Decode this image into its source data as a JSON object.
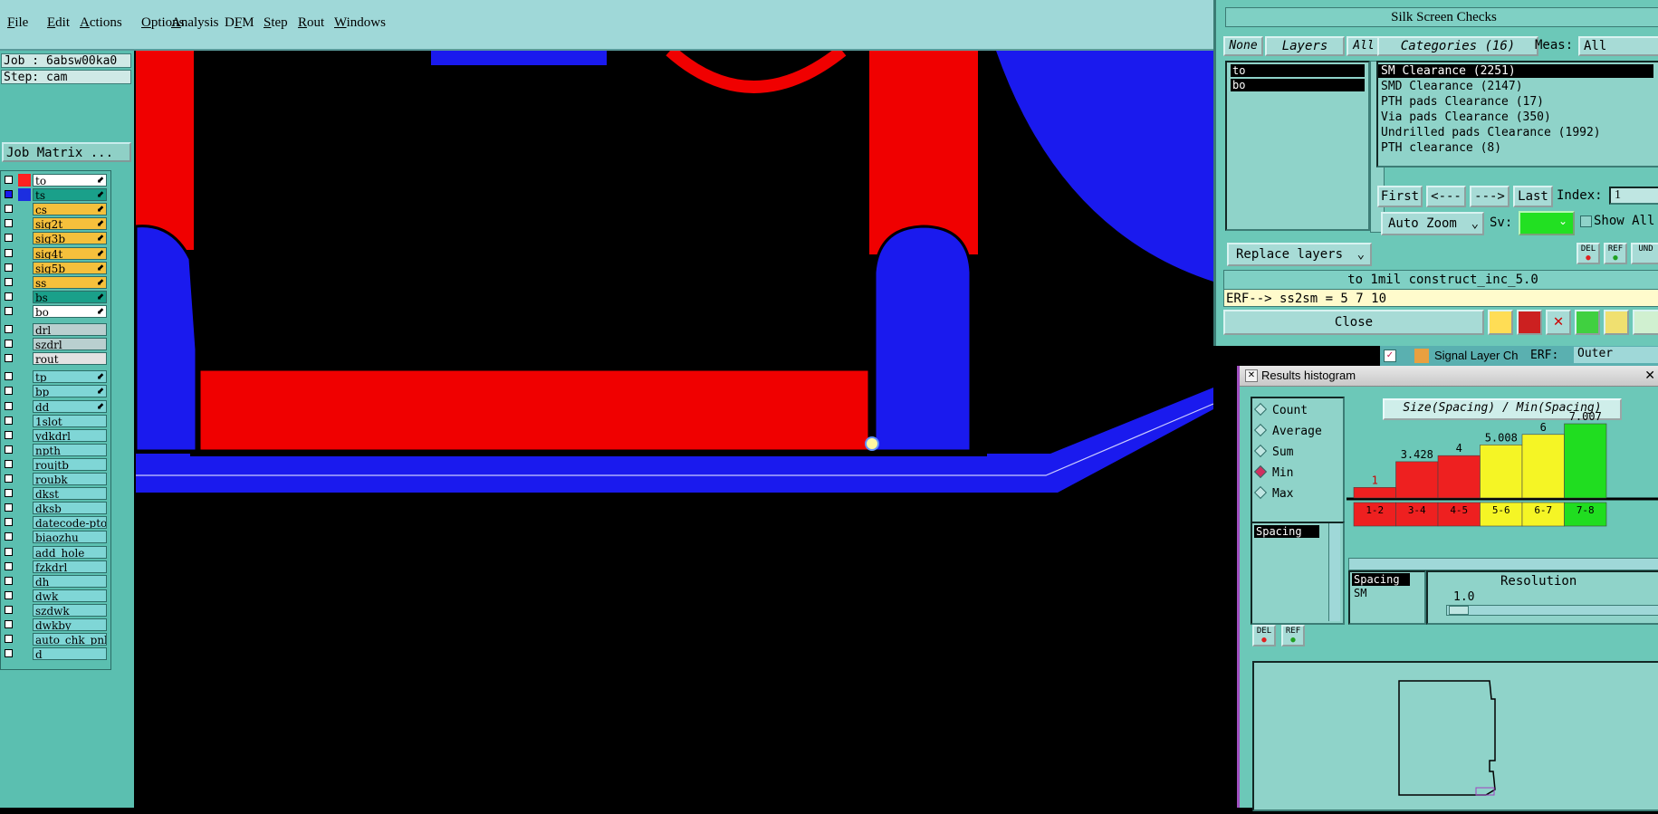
{
  "menubar": {
    "items": [
      {
        "pre": "",
        "u": "F",
        "post": "ile"
      },
      {
        "pre": "",
        "u": "E",
        "post": "dit"
      },
      {
        "pre": "",
        "u": "A",
        "post": "ctions"
      },
      {
        "pre": "",
        "u": "O",
        "post": "ptions"
      },
      {
        "pre": "",
        "u": "A",
        "post": "nalysis"
      },
      {
        "pre": "D",
        "u": "F",
        "post": "M"
      },
      {
        "pre": "",
        "u": "S",
        "post": "tep"
      },
      {
        "pre": "",
        "u": "R",
        "post": "out"
      },
      {
        "pre": "",
        "u": "W",
        "post": "indows"
      }
    ]
  },
  "left": {
    "job": "Job : 6absw00ka0",
    "step": "Step: cam",
    "job_matrix": "Job Matrix ...",
    "layers": [
      {
        "name": "to",
        "swatch": "#ff2020",
        "color": "#ffffff",
        "arrow": true,
        "checked": false
      },
      {
        "name": "ts",
        "swatch": "#1c2ee0",
        "color": "#1aa08a",
        "arrow": true,
        "checked": true
      },
      {
        "name": "cs",
        "swatch": "",
        "color": "#f5c03c",
        "arrow": true,
        "checked": false
      },
      {
        "name": "sig2t",
        "swatch": "",
        "color": "#f5c03c",
        "arrow": true,
        "checked": false
      },
      {
        "name": "sig3b",
        "swatch": "",
        "color": "#f5c03c",
        "arrow": true,
        "checked": false
      },
      {
        "name": "sig4t",
        "swatch": "",
        "color": "#f5c03c",
        "arrow": true,
        "checked": false
      },
      {
        "name": "sig5b",
        "swatch": "",
        "color": "#f5c03c",
        "arrow": true,
        "checked": false
      },
      {
        "name": "ss",
        "swatch": "",
        "color": "#f5c03c",
        "arrow": true,
        "checked": false
      },
      {
        "name": "bs",
        "swatch": "",
        "color": "#1aa08a",
        "arrow": true,
        "checked": false
      },
      {
        "name": "bo",
        "swatch": "",
        "color": "#ffffff",
        "arrow": true,
        "checked": false
      },
      {
        "name": "drl",
        "swatch": "",
        "color": "#b9cfcf",
        "arrow": false,
        "checked": false
      },
      {
        "name": "szdrl",
        "swatch": "",
        "color": "#b9cfcf",
        "arrow": false,
        "checked": false
      },
      {
        "name": "rout",
        "swatch": "",
        "color": "#e2e2e2",
        "arrow": false,
        "checked": false
      },
      {
        "name": "tp",
        "swatch": "",
        "color": "#7fd6d6",
        "arrow": true,
        "checked": false
      },
      {
        "name": "bp",
        "swatch": "",
        "color": "#7fd6d6",
        "arrow": true,
        "checked": false
      },
      {
        "name": "dd",
        "swatch": "",
        "color": "#7fd6d6",
        "arrow": true,
        "checked": false
      },
      {
        "name": "1slot",
        "swatch": "",
        "color": "#7fd6d6",
        "arrow": false,
        "checked": false
      },
      {
        "name": "ydkdrl",
        "swatch": "",
        "color": "#7fd6d6",
        "arrow": false,
        "checked": false
      },
      {
        "name": "npth",
        "swatch": "",
        "color": "#7fd6d6",
        "arrow": false,
        "checked": false
      },
      {
        "name": "roujtb",
        "swatch": "",
        "color": "#7fd6d6",
        "arrow": false,
        "checked": false
      },
      {
        "name": "roubk",
        "swatch": "",
        "color": "#7fd6d6",
        "arrow": false,
        "checked": false
      },
      {
        "name": "dkst",
        "swatch": "",
        "color": "#7fd6d6",
        "arrow": false,
        "checked": false
      },
      {
        "name": "dksb",
        "swatch": "",
        "color": "#7fd6d6",
        "arrow": false,
        "checked": false
      },
      {
        "name": "datecode-pto",
        "swatch": "",
        "color": "#7fd6d6",
        "arrow": false,
        "checked": false
      },
      {
        "name": "biaozhu",
        "swatch": "",
        "color": "#7fd6d6",
        "arrow": false,
        "checked": false
      },
      {
        "name": "add_hole",
        "swatch": "",
        "color": "#7fd6d6",
        "arrow": false,
        "checked": false
      },
      {
        "name": "fzkdrl",
        "swatch": "",
        "color": "#7fd6d6",
        "arrow": false,
        "checked": false
      },
      {
        "name": "dh",
        "swatch": "",
        "color": "#7fd6d6",
        "arrow": false,
        "checked": false
      },
      {
        "name": "dwk",
        "swatch": "",
        "color": "#7fd6d6",
        "arrow": false,
        "checked": false
      },
      {
        "name": "szdwk",
        "swatch": "",
        "color": "#7fd6d6",
        "arrow": false,
        "checked": false
      },
      {
        "name": "dwkby",
        "swatch": "",
        "color": "#7fd6d6",
        "arrow": false,
        "checked": false
      },
      {
        "name": "auto_chk_pnl",
        "swatch": "",
        "color": "#7fd6d6",
        "arrow": false,
        "checked": false
      },
      {
        "name": "d",
        "swatch": "",
        "color": "#7fd6d6",
        "arrow": false,
        "checked": false
      }
    ]
  },
  "silk": {
    "title": "Silk Screen Checks",
    "none_label": "None",
    "layers_label": "Layers",
    "all_label": "All",
    "layers": [
      "to",
      "bo"
    ],
    "categories_label": "Categories (16)",
    "meas_label": "Meas:",
    "meas_value": "All",
    "categories": [
      "SM Clearance (2251)",
      "SMD Clearance (2147)",
      "PTH pads Clearance (17)",
      "Via pads Clearance (350)",
      "Undrilled pads Clearance (1992)",
      "PTH clearance (8)"
    ],
    "first_label": "First",
    "prev_label": "<---",
    "next_label": "--->",
    "last_label": "Last",
    "index_label": "Index:",
    "index_value": "1",
    "autozoom_label": "Auto Zoom",
    "sv_label": "Sv:",
    "showall_label": "Show All",
    "replace_label": "Replace layers",
    "status": "to 1mil  construct_inc_5.0",
    "erf_line": "ERF--> ss2sm = 5 7 10",
    "close_label": "Close",
    "del_label": "DEL",
    "ref_label": "REF",
    "und_label": "UND"
  },
  "signal": {
    "label": "Signal Layer Ch",
    "erf_label": "ERF:",
    "erf_value": "Outer"
  },
  "hist": {
    "title": "Results histogram",
    "options": [
      {
        "label": "Count",
        "on": false
      },
      {
        "label": "Average",
        "on": false
      },
      {
        "label": "Sum",
        "on": false
      },
      {
        "label": "Min",
        "on": true
      },
      {
        "label": "Max",
        "on": false
      }
    ],
    "measure_list": [
      "Spacing"
    ],
    "param_list": [
      "Spacing",
      "SM"
    ],
    "chart_caption": "Size(Spacing) / Min(Spacing)",
    "resolution_label": "Resolution",
    "resolution_value": "1.0",
    "del_label": "DEL",
    "ref_label": "REF"
  },
  "chart_data": {
    "type": "bar",
    "title": "Size(Spacing) / Min(Spacing)",
    "categories": [
      "1-2",
      "3-4",
      "4-5",
      "5-6",
      "6-7",
      "7-8"
    ],
    "values": [
      1,
      3.428,
      4,
      5.008,
      6,
      7.007
    ],
    "value_labels": [
      "1",
      "3.428",
      "4",
      "5.008",
      "6",
      "7.007"
    ],
    "colors": [
      "#ee2020",
      "#ee2020",
      "#ee2020",
      "#f5f525",
      "#f5f525",
      "#20dd20"
    ],
    "ylim": [
      0,
      7.007
    ]
  },
  "canvas_colors": {
    "red": "#f00000",
    "blue": "#1a1aee",
    "outline": "#000000"
  }
}
